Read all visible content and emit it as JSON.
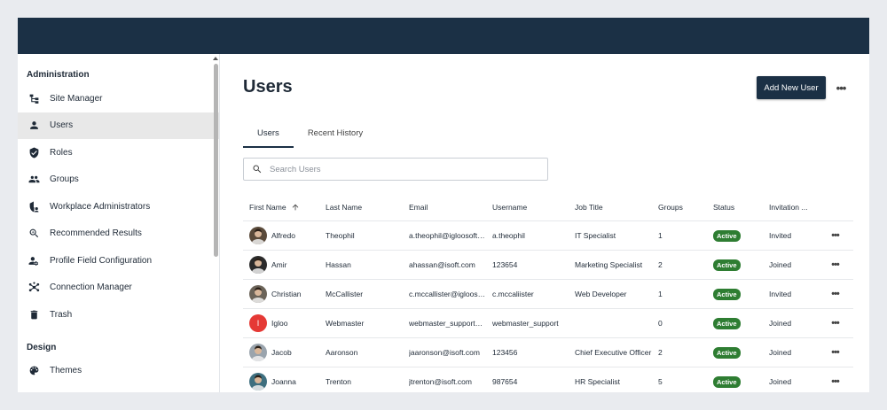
{
  "sidebar": {
    "admin_title": "Administration",
    "admin_items": [
      {
        "label": "Site Manager",
        "icon": "sitemap-icon"
      },
      {
        "label": "Users",
        "icon": "person-icon",
        "active": true
      },
      {
        "label": "Roles",
        "icon": "shield-icon"
      },
      {
        "label": "Groups",
        "icon": "group-icon"
      },
      {
        "label": "Workplace Administrators",
        "icon": "admin-shield-icon"
      },
      {
        "label": "Recommended Results",
        "icon": "search-plus-icon"
      },
      {
        "label": "Profile Field Configuration",
        "icon": "person-gear-icon"
      },
      {
        "label": "Connection Manager",
        "icon": "hub-icon"
      },
      {
        "label": "Trash",
        "icon": "trash-icon"
      }
    ],
    "design_title": "Design",
    "design_items": [
      {
        "label": "Themes",
        "icon": "palette-icon"
      }
    ]
  },
  "main": {
    "title": "Users",
    "add_button": "Add New User",
    "tabs": [
      "Users",
      "Recent History"
    ],
    "search_placeholder": "Search Users"
  },
  "table": {
    "columns": [
      "First Name",
      "Last Name",
      "Email",
      "Username",
      "Job Title",
      "Groups",
      "Status",
      "Invitation ..."
    ],
    "rows": [
      {
        "first": "Alfredo",
        "last": "Theophil",
        "email": "a.theophil@igloosoftware.com",
        "username": "a.theophil",
        "job": "IT Specialist",
        "groups": "1",
        "status": "Active",
        "invitation": "Invited",
        "avatar_color": "#5a4a3a",
        "initial": ""
      },
      {
        "first": "Amir",
        "last": "Hassan",
        "email": "ahassan@isoft.com",
        "username": "123654",
        "job": "Marketing Specialist",
        "groups": "2",
        "status": "Active",
        "invitation": "Joined",
        "avatar_color": "#2b2b2b",
        "initial": ""
      },
      {
        "first": "Christian",
        "last": "McCallister",
        "email": "c.mccallister@igloosoftware.com",
        "username": "c.mccaliister",
        "job": "Web Developer",
        "groups": "1",
        "status": "Active",
        "invitation": "Invited",
        "avatar_color": "#6b6358",
        "initial": ""
      },
      {
        "first": "Igloo",
        "last": "Webmaster",
        "email": "webmaster_support@igloosoftware.com",
        "username": "webmaster_support",
        "job": "",
        "groups": "0",
        "status": "Active",
        "invitation": "Joined",
        "avatar_color": "#e53935",
        "initial": "I"
      },
      {
        "first": "Jacob",
        "last": "Aaronson",
        "email": "jaaronson@isoft.com",
        "username": "123456",
        "job": "Chief Executive Officer",
        "groups": "2",
        "status": "Active",
        "invitation": "Joined",
        "avatar_color": "#9aa4ad",
        "initial": ""
      },
      {
        "first": "Joanna",
        "last": "Trenton",
        "email": "jtrenton@isoft.com",
        "username": "987654",
        "job": "HR Specialist",
        "groups": "5",
        "status": "Active",
        "invitation": "Joined",
        "avatar_color": "#3e6f7f",
        "initial": ""
      }
    ]
  },
  "colors": {
    "topbar": "#1b3045",
    "active_badge": "#2e7d32",
    "accent": "#1b3045"
  }
}
